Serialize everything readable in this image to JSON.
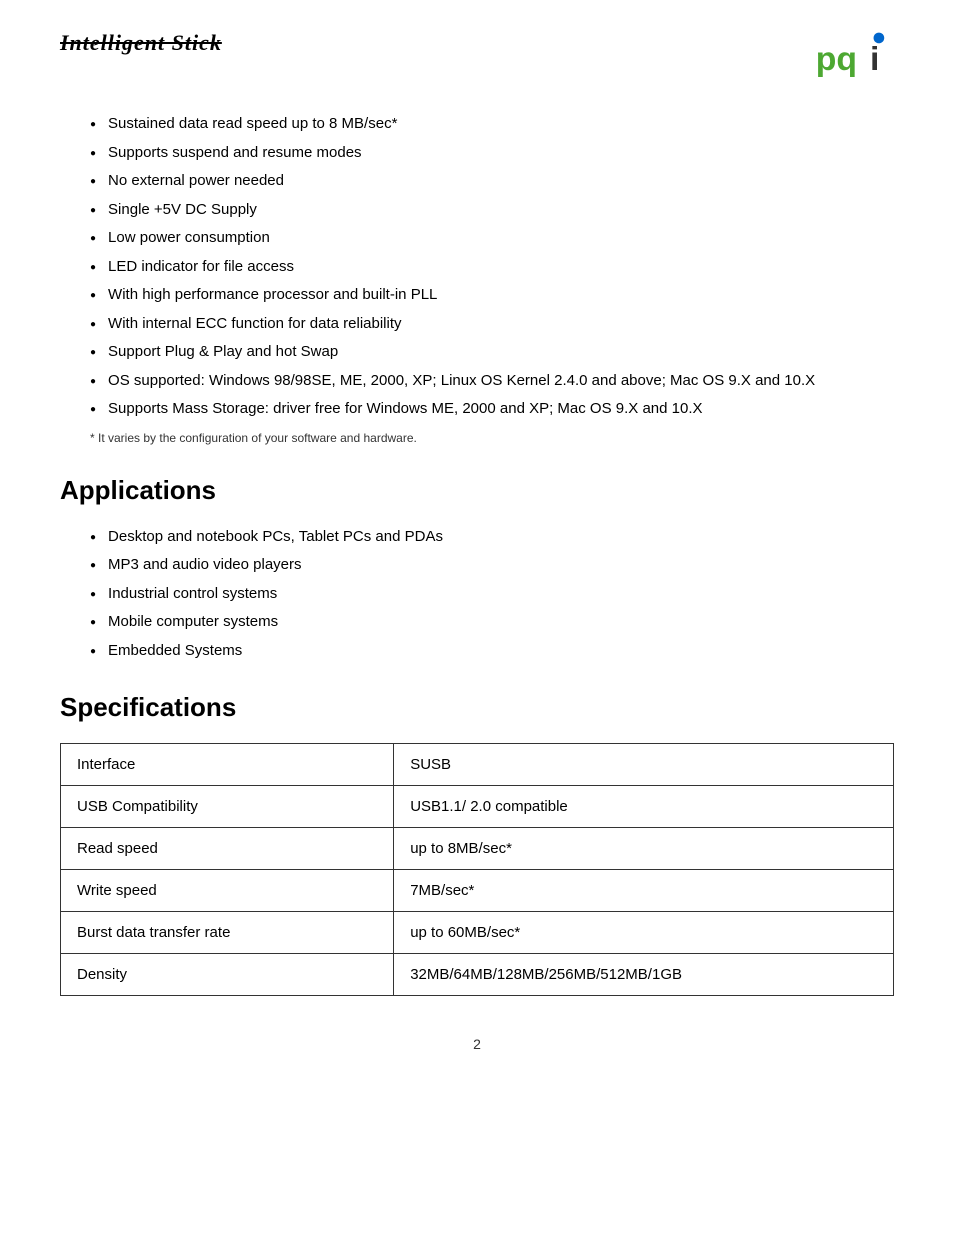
{
  "header": {
    "brand_title": "Intelligent Stick",
    "logo_alt": "PQI Logo"
  },
  "features": {
    "items": [
      "Sustained data read speed up to 8 MB/sec*",
      "Supports suspend and resume modes",
      "No external power needed",
      "Single +5V DC Supply",
      "Low power consumption",
      "LED indicator for file access",
      "With high performance processor and built-in PLL",
      "With internal ECC function for data reliability",
      "Support Plug & Play and hot Swap",
      "OS supported: Windows 98/98SE, ME, 2000, XP; Linux OS Kernel 2.4.0 and above; Mac OS 9.X and 10.X",
      "Supports Mass Storage: driver free for Windows ME, 2000 and XP; Mac OS 9.X and 10.X"
    ],
    "footnote": "* It varies by the configuration of your software and hardware."
  },
  "applications": {
    "title": "Applications",
    "items": [
      "Desktop and notebook PCs, Tablet PCs and PDAs",
      "MP3 and audio video players",
      "Industrial control systems",
      "Mobile computer systems",
      "Embedded Systems"
    ]
  },
  "specifications": {
    "title": "Specifications",
    "rows": [
      {
        "label": "Interface",
        "value": "SUSB"
      },
      {
        "label": "USB Compatibility",
        "value": "USB1.1/ 2.0 compatible"
      },
      {
        "label": "Read speed",
        "value": "up to 8MB/sec*"
      },
      {
        "label": "Write speed",
        "value": "7MB/sec*"
      },
      {
        "label": "Burst data transfer rate",
        "value": "up to 60MB/sec*"
      },
      {
        "label": "Density",
        "value": "32MB/64MB/128MB/256MB/512MB/1GB"
      }
    ]
  },
  "page_number": "2"
}
